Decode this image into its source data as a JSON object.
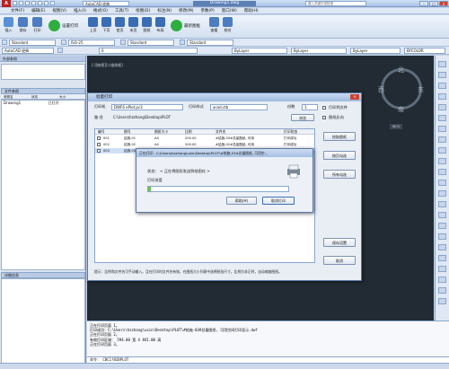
{
  "title_bar": {
    "logo": "A",
    "workspace": "AutoCAD 经典",
    "doc_title": "Drawing1.dwg",
    "search_placeholder": "键入关键字或短语",
    "controls": [
      "–",
      "□",
      "×"
    ]
  },
  "menu": [
    "文件(F)",
    "编辑(E)",
    "视图(V)",
    "插入(I)",
    "格式(O)",
    "工具(T)",
    "绘图(D)",
    "标注(N)",
    "修改(M)",
    "参数(P)",
    "窗口(W)",
    "帮助(H)"
  ],
  "ribbon": {
    "buttons": [
      {
        "label": "插入",
        "color": "#5a8fd6"
      },
      {
        "label": "保存",
        "color": "#4e7cc2"
      },
      {
        "label": "打印",
        "color": "#4e7cc2"
      },
      {
        "label": "设置打印",
        "color": "#2fae3f"
      },
      {
        "label": "上页",
        "color": "#3a6db4"
      },
      {
        "label": "下页",
        "color": "#3a6db4"
      },
      {
        "label": "首页",
        "color": "#3a6db4"
      },
      {
        "label": "末页",
        "color": "#3a6db4"
      },
      {
        "label": "图纸",
        "color": "#3a6db4"
      },
      {
        "label": "布局",
        "color": "#3a6db4"
      },
      {
        "label": "最新图框",
        "color": "#2fae3f"
      },
      {
        "label": "查看",
        "color": "#4e7cc2"
      },
      {
        "label": "校对",
        "color": "#4e7cc2"
      }
    ]
  },
  "props": {
    "style1": "Standard",
    "dim": "ISO-25",
    "style2": "Standard",
    "style3": "Standard",
    "ws": "AutoCAD 经典",
    "layer": "0",
    "bylayer1": "ByLayer",
    "bylayer2": "ByLayer",
    "bylayer3": "ByLayer",
    "bycolor": "BYCOLOR"
  },
  "palette": {
    "header": "外部参照",
    "file_header": "文件参照",
    "columns": [
      "参照名",
      "状态",
      "大小"
    ],
    "row": {
      "name": "Drawing1",
      "status": "已打开"
    },
    "detail_header": "详细信息"
  },
  "canvas": {
    "label": "[-][俯视][二维线框]",
    "compass": {
      "n": "北",
      "s": "南",
      "e": "东",
      "w": "西"
    },
    "wcs": "WCS"
  },
  "plot_dialog": {
    "title": "批量打印",
    "printer_label": "打印机",
    "printer": "DWF6 ePlot.pc3",
    "style_label": "打印样式",
    "style": "acad.ctb",
    "copies_label": "份数",
    "copies": "1",
    "path_label": "路 径",
    "path": "C:\\Users\\hzzhang\\Desktop\\PLOT",
    "browse": "浏览",
    "plot_to_file": "打印到文件",
    "reverse": "图纸反向",
    "columns": [
      "编号",
      "图号",
      "图纸大小",
      "比例",
      "文件名",
      "打印状态"
    ],
    "rows": [
      {
        "no": "001",
        "code": "结施-01",
        "size": "A4",
        "scale": "200.00",
        "file": "#结施-03#总量图纸, 可用",
        "status": "打印成功"
      },
      {
        "no": "002",
        "code": "结施-02",
        "size": "A4",
        "scale": "200.00",
        "file": "#结施-02#总量图纸, 可用",
        "status": "打印成功"
      },
      {
        "no": "003",
        "code": "结施-03",
        "size": "A4",
        "scale": "200.00",
        "file": "#结施-03#总量图纸, 可用",
        "status": ""
      }
    ],
    "side_buttons": [
      "拾取图纸",
      "按页勾选",
      "所有勾选",
      "保存设置",
      "取消"
    ],
    "tip": "提示：比例和文件名可手动输入，且在打印时文件名有效，在图纸大小列表中选择纸张尺寸，比例为非正时，自动缩放图纸。"
  },
  "progress_dialog": {
    "title": "正在打印：C:\\Users\\hzzhang\\uxin\\Desktop\\PLOT\\#结施-03#总量图纸, 可用空...",
    "status_label": "状态：",
    "status": "< 正在将图形发送到绘图仪 >",
    "progress_label": "打印进度",
    "progress": 0.02,
    "help": "帮助(H)",
    "cancel": "取消打印"
  },
  "command": {
    "lines": [
      "正在打印页面 1。",
      "打印成功：C:\\Users\\hzzhang\\uxin\\Desktop\\PLOT\\#结施-03#总量图纸, 可用空间打印显示.dwf",
      "正在打印页面 2。",
      "有效打印区域： 594.00 宽 X 841.00 高",
      "正在打印页面 3。"
    ],
    "prompt": "命令： CBC1?BIBPLOT"
  }
}
